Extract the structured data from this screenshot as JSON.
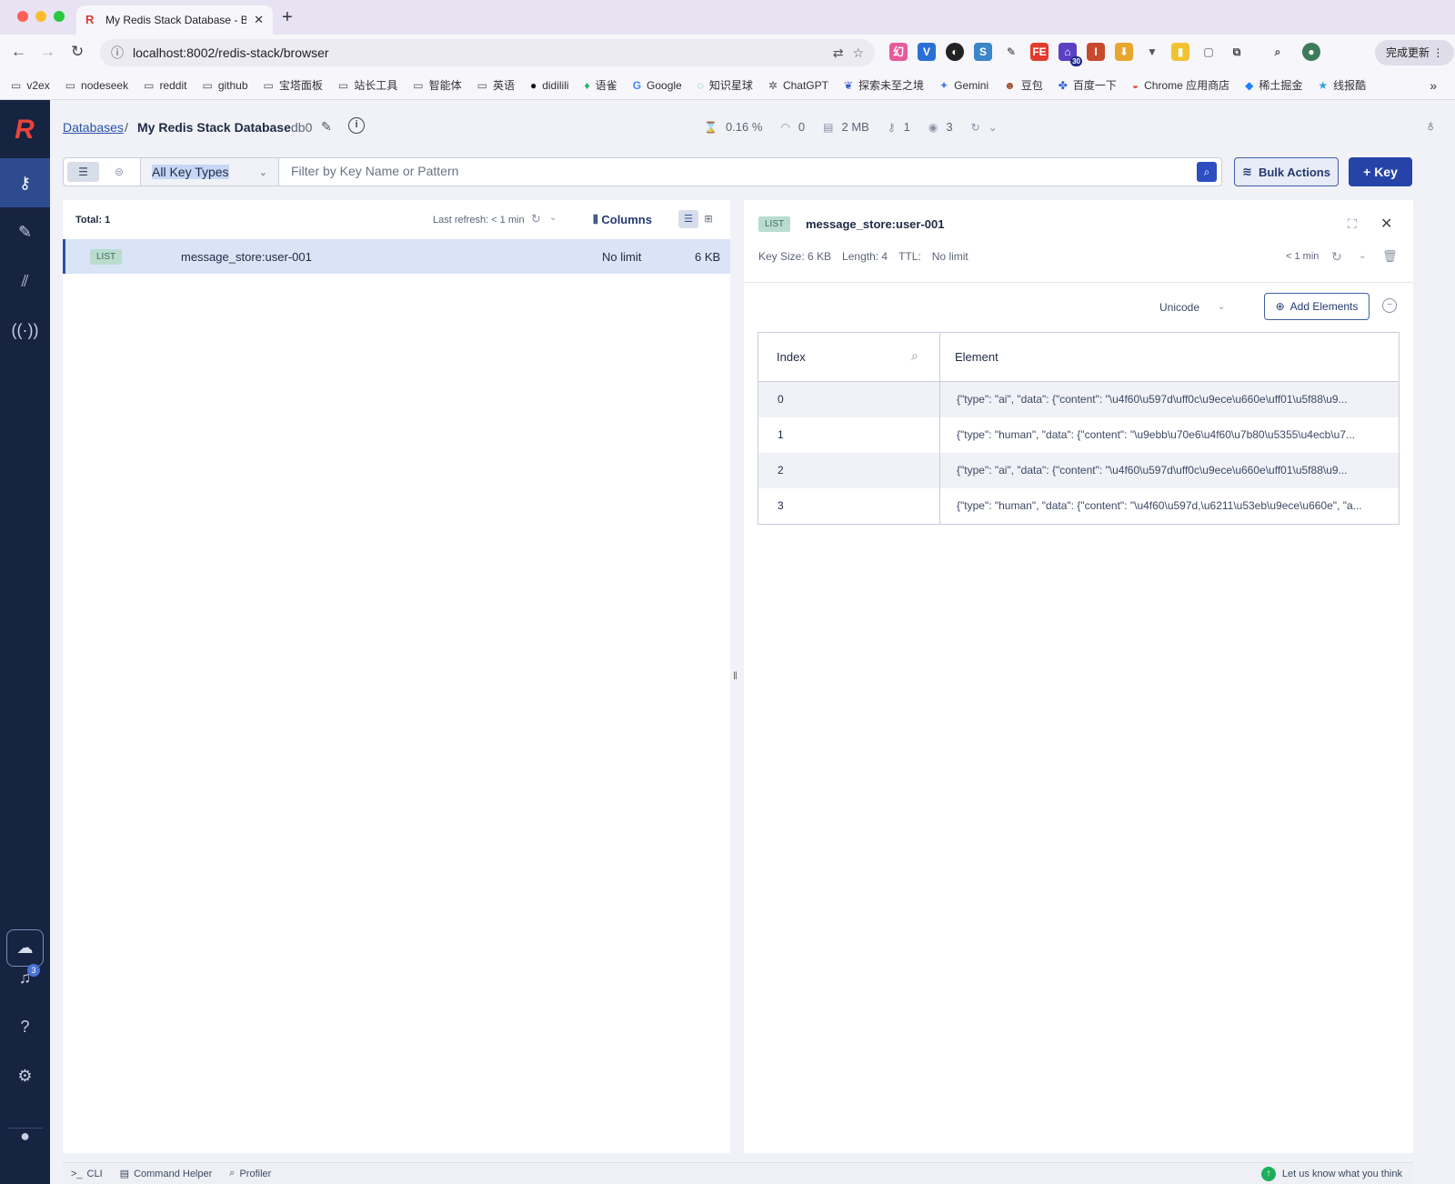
{
  "browser": {
    "tab_title": "My Redis Stack Database - B",
    "url": "localhost:8002/redis-stack/browser",
    "update_button": "完成更新",
    "extension_badge": "30",
    "bookmarks": [
      "v2ex",
      "nodeseek",
      "reddit",
      "github",
      "宝塔面板",
      "站长工具",
      "智能体",
      "英语",
      "didilili",
      "语雀",
      "Google",
      "知识星球",
      "ChatGPT",
      "探索未至之境",
      "Gemini",
      "豆包",
      "百度一下",
      "Chrome 应用商店",
      "稀土掘金",
      "线报酷"
    ]
  },
  "header": {
    "breadcrumb_link": "Databases",
    "breadcrumb_sep": "/",
    "database_name": "My Redis Stack Database",
    "db_index": "db0",
    "stats": {
      "cpu": "0.16 %",
      "commands": "0",
      "memory": "2 MB",
      "keys": "1",
      "clients": "3"
    }
  },
  "filter": {
    "key_type": "All Key Types",
    "placeholder": "Filter by Key Name or Pattern",
    "bulk_actions": "Bulk Actions",
    "add_key": "+ Key"
  },
  "key_list": {
    "total": "Total: 1",
    "last_refresh": "Last refresh: < 1 min",
    "columns_label": "Columns",
    "rows": [
      {
        "type": "LIST",
        "name": "message_store:user-001",
        "ttl": "No limit",
        "size": "6 KB"
      }
    ]
  },
  "key_details": {
    "type": "LIST",
    "name": "message_store:user-001",
    "key_size": "Key Size: 6 KB",
    "length": "Length: 4",
    "ttl_label": "TTL:",
    "ttl_value": "No limit",
    "refreshed": "< 1 min",
    "format": "Unicode",
    "add_elements": "Add Elements",
    "columns": {
      "index": "Index",
      "element": "Element"
    },
    "elements": [
      {
        "index": "0",
        "value": "{\"type\": \"ai\", \"data\": {\"content\": \"\\u4f60\\u597d\\uff0c\\u9ece\\u660e\\uff01\\u5f88\\u9..."
      },
      {
        "index": "1",
        "value": "{\"type\": \"human\", \"data\": {\"content\": \"\\u9ebb\\u70e6\\u4f60\\u7b80\\u5355\\u4ecb\\u7..."
      },
      {
        "index": "2",
        "value": "{\"type\": \"ai\", \"data\": {\"content\": \"\\u4f60\\u597d\\uff0c\\u9ece\\u660e\\uff01\\u5f88\\u9..."
      },
      {
        "index": "3",
        "value": "{\"type\": \"human\", \"data\": {\"content\": \"\\u4f60\\u597d,\\u6211\\u53eb\\u9ece\\u660e\", \"a..."
      }
    ]
  },
  "sidebar": {
    "notification_count": "3"
  },
  "bottom_bar": {
    "cli": "CLI",
    "command_helper": "Command Helper",
    "profiler": "Profiler",
    "feedback": "Let us know what you think"
  }
}
